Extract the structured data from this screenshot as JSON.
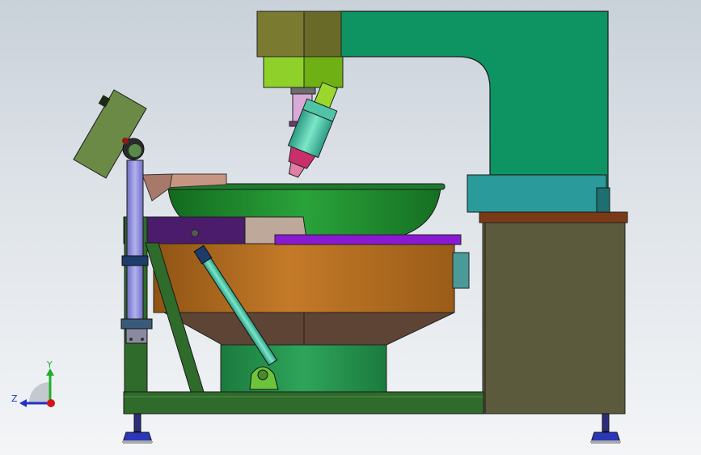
{
  "view": {
    "title": "",
    "background_top": "#c9d1d9",
    "background_bottom": "#f3f5f7"
  },
  "triad": {
    "y_label": "Y",
    "z_label": "Z",
    "y_color": "#1fae2b",
    "z_color": "#2231c8",
    "x_color": "#d01616"
  },
  "colors": {
    "column_green": "#0e9462",
    "head_olive": "#7a7a30",
    "lime": "#8fd12a",
    "bowl_green": "#1e8a2c",
    "kettle_brown": "#b56d1f",
    "cabinet": "#5c5a3c",
    "frame_green": "#2f6b2a",
    "purple_rail": "#8a1ad1",
    "teal_cylinder": "#4ec4a6",
    "panel_olive": "#6b8a45"
  }
}
